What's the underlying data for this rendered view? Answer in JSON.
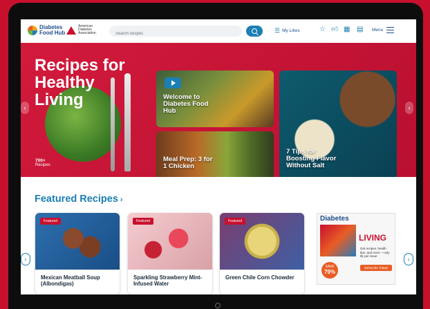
{
  "header": {
    "logo_name": "Diabetes Food Hub",
    "ada_name": "American Diabetes Association.",
    "search_placeholder": "Search recipes",
    "my_likes": "My Likes",
    "menu": "Menu"
  },
  "hero": {
    "title": "Recipes for Healthy Living",
    "count_value": "700+",
    "count_label": "Recipes",
    "cards": [
      {
        "label": "Welcome to Diabetes Food Hub"
      },
      {
        "label": "Meal Prep: 3 for 1 Chicken"
      },
      {
        "label": "7 Tips for Boosting Flavor Without Salt"
      }
    ]
  },
  "featured": {
    "title": "Featured Recipes",
    "tag": "Featured",
    "recipes": [
      {
        "name": "Mexican Meatball Soup (Albondigas)"
      },
      {
        "name": "Sparkling Strawberry Mint-Infused Water"
      },
      {
        "name": "Green Chile Corn Chowder"
      }
    ],
    "magazine": {
      "title": "Diabetes",
      "living": "LIVING",
      "save_value": "79%",
      "save_label": "SAVE",
      "offer": "Get recipes, health tips, and more —only $1 per issue",
      "cta": "Subscribe Today!"
    }
  },
  "colors": {
    "brand_red": "#c8102e",
    "accent_blue": "#1c7fb3",
    "navy": "#1f4e8c"
  }
}
